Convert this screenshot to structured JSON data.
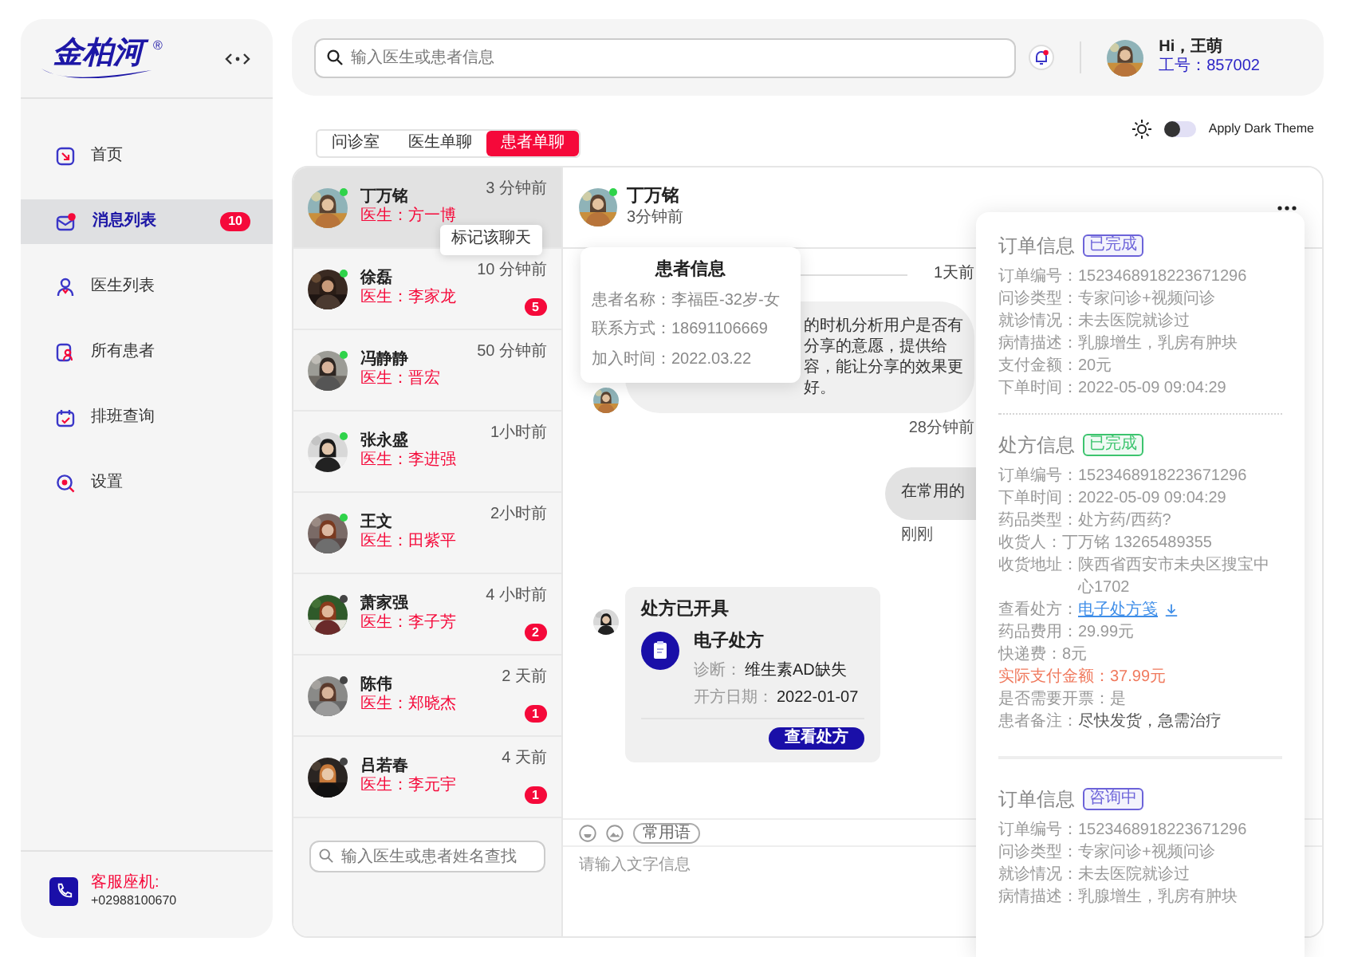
{
  "sidebar": {
    "logo": "金柏河",
    "logo_mark": "®",
    "nav": [
      {
        "label": "首页",
        "selected": false
      },
      {
        "label": "消息列表",
        "selected": true,
        "badge": "10"
      },
      {
        "label": "医生列表",
        "selected": false
      },
      {
        "label": "所有患者",
        "selected": false
      },
      {
        "label": "排班查询",
        "selected": false
      },
      {
        "label": "设置",
        "selected": false
      }
    ],
    "footer": {
      "label": "客服座机:",
      "phone": "+02988100670"
    }
  },
  "header": {
    "search": {
      "placeholder": "输入医生或患者信息"
    },
    "user": {
      "greeting": "Hi，王萌",
      "staff_id": "工号：857002"
    }
  },
  "tabs": [
    {
      "label": "问诊室",
      "selected": false
    },
    {
      "label": "医生单聊",
      "selected": false
    },
    {
      "label": "患者单聊",
      "selected": true
    }
  ],
  "theme": {
    "label": "Apply Dark Theme",
    "on": false
  },
  "conversations": {
    "items": [
      {
        "name": "丁万铭",
        "doctor": "医生：方一博",
        "time": "3 分钟前",
        "online": true,
        "selected": true
      },
      {
        "name": "徐磊",
        "doctor": "医生：李家龙",
        "time": "10 分钟前",
        "unread": "5",
        "online": true,
        "selected": false
      },
      {
        "name": "冯静静",
        "doctor": "医生：晋宏",
        "time": "50 分钟前",
        "online": true,
        "selected": false
      },
      {
        "name": "张永盛",
        "doctor": "医生：李进强",
        "time": "1小时前",
        "online": true,
        "selected": false
      },
      {
        "name": "王文",
        "doctor": "医生：田紫平",
        "time": "2小时前",
        "online": true,
        "selected": false
      },
      {
        "name": "萧家强",
        "doctor": "医生：李子芳",
        "time": "4 小时前",
        "unread": "2",
        "online": false,
        "selected": false
      },
      {
        "name": "陈伟",
        "doctor": "医生：郑晓杰",
        "time": "2 天前",
        "unread": "1",
        "online": false,
        "selected": false
      },
      {
        "name": "吕若春",
        "doctor": "医生：李元宇",
        "time": "4 天前",
        "unread": "1",
        "online": false,
        "selected": false
      }
    ],
    "tooltip": "标记该聊天",
    "search": {
      "placeholder": "输入医生或患者姓名查找"
    }
  },
  "chat": {
    "name": "丁万铭",
    "time": "3分钟前",
    "online": true,
    "messages": [
      {
        "kind": "divider",
        "text": "1天前"
      },
      {
        "kind": "incoming",
        "lines": [
          "的时机分析用户是否有分享的意愿，提供给",
          "容，能让分享的效果更好。"
        ],
        "time": "28分钟前"
      },
      {
        "kind": "outgoing",
        "text": "在常用的",
        "time": "刚刚"
      },
      {
        "kind": "prescription",
        "title": "处方已开具",
        "heading": "电子处方",
        "fields": [
          {
            "label": "诊断：",
            "value": "维生素AD缺失"
          },
          {
            "label": "开方日期：",
            "value": "2022-01-07"
          }
        ],
        "button": "查看处方"
      }
    ],
    "quick_reply": "常用语",
    "input": {
      "placeholder": "请输入文字信息"
    },
    "patient_popup": {
      "title": "患者信息",
      "lines": [
        "患者名称：李福臣-32岁-女",
        "联系方式：18691106669",
        "加入时间：2022.03.22"
      ]
    }
  },
  "details": [
    {
      "title": "订单信息",
      "status": {
        "label": "已完成",
        "color": "#6c63d9"
      },
      "lines": [
        {
          "kind": "text",
          "label": "订单编号：",
          "value": "1523468918223671296"
        },
        {
          "kind": "text",
          "label": "问诊类型：",
          "value": "专家问诊+视频问诊"
        },
        {
          "kind": "text",
          "label": "就诊情况：",
          "value": "未去医院就诊过"
        },
        {
          "kind": "text",
          "label": "病情描述：",
          "value": "乳腺增生，乳房有肿块"
        },
        {
          "kind": "text",
          "label": "支付金额：",
          "value": "20元"
        },
        {
          "kind": "text",
          "label": "下单时间：",
          "value": "2022-05-09 09:04:29"
        }
      ]
    },
    {
      "title": "处方信息",
      "status": {
        "label": "已完成",
        "color": "#3cc46e"
      },
      "lines": [
        {
          "kind": "text",
          "label": "订单编号：",
          "value": "1523468918223671296"
        },
        {
          "kind": "text",
          "label": "下单时间：",
          "value": "2022-05-09 09:04:29"
        },
        {
          "kind": "text",
          "label": "药品类型：",
          "value": "处方药/西药?"
        },
        {
          "kind": "text",
          "label": "收货人：",
          "value": "丁万铭 13265489355"
        },
        {
          "kind": "text",
          "label": "收货地址：",
          "value": "陕西省西安市未央区搜宝中心1702"
        },
        {
          "kind": "link",
          "label": "查看处方：",
          "value": "电子处方笺"
        },
        {
          "kind": "text",
          "label": "药品费用：",
          "value": "29.99元"
        },
        {
          "kind": "text",
          "label": "快递费：",
          "value": "8元"
        },
        {
          "kind": "alert",
          "label": "实际支付金额：",
          "value": "37.99元"
        },
        {
          "kind": "text",
          "label": "是否需要开票：",
          "value": "是"
        },
        {
          "kind": "note",
          "label": "患者备注：",
          "value": "尽快发货，急需治疗"
        }
      ]
    },
    {
      "title": "订单信息",
      "status": {
        "label": "咨询中",
        "color": "#6c63d9"
      },
      "lines": [
        {
          "kind": "text",
          "label": "订单编号：",
          "value": "1523468918223671296"
        },
        {
          "kind": "text",
          "label": "问诊类型：",
          "value": "专家问诊+视频问诊"
        },
        {
          "kind": "text",
          "label": "就诊情况：",
          "value": "未去医院就诊过"
        },
        {
          "kind": "text",
          "label": "病情描述：",
          "value": "乳腺增生，乳房有肿块"
        }
      ]
    }
  ]
}
